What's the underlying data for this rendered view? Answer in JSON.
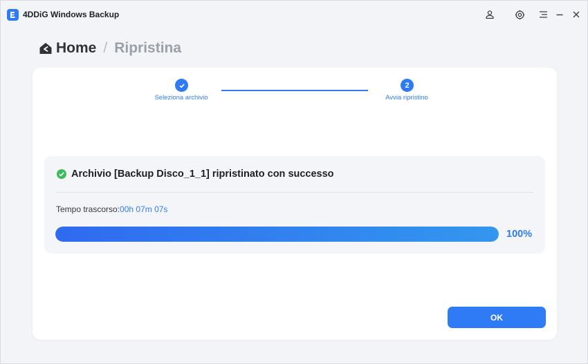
{
  "app": {
    "title": "4DDiG Windows Backup",
    "accent_color": "#2f7bf6"
  },
  "titlebar_icons": [
    "account-icon",
    "settings-icon",
    "menu-icon",
    "minimize-icon",
    "close-icon"
  ],
  "breadcrumb": {
    "home": "Home",
    "separator": "/",
    "current": "Ripristina"
  },
  "stepper": {
    "steps": [
      {
        "label": "Seleziona archivio",
        "marker": "✓",
        "state": "completed"
      },
      {
        "label": "Avvia ripristino",
        "marker": "2",
        "state": "active"
      }
    ]
  },
  "result": {
    "title": "Archivio [Backup Disco_1_1] ripristinato con successo",
    "elapsed_label": "Tempo trascorso:",
    "elapsed_value": "00h 07m 07s",
    "progress_percent": 100,
    "progress_text": "100%",
    "status_color": "#3dbb5c"
  },
  "ok_button": {
    "label": "OK"
  }
}
